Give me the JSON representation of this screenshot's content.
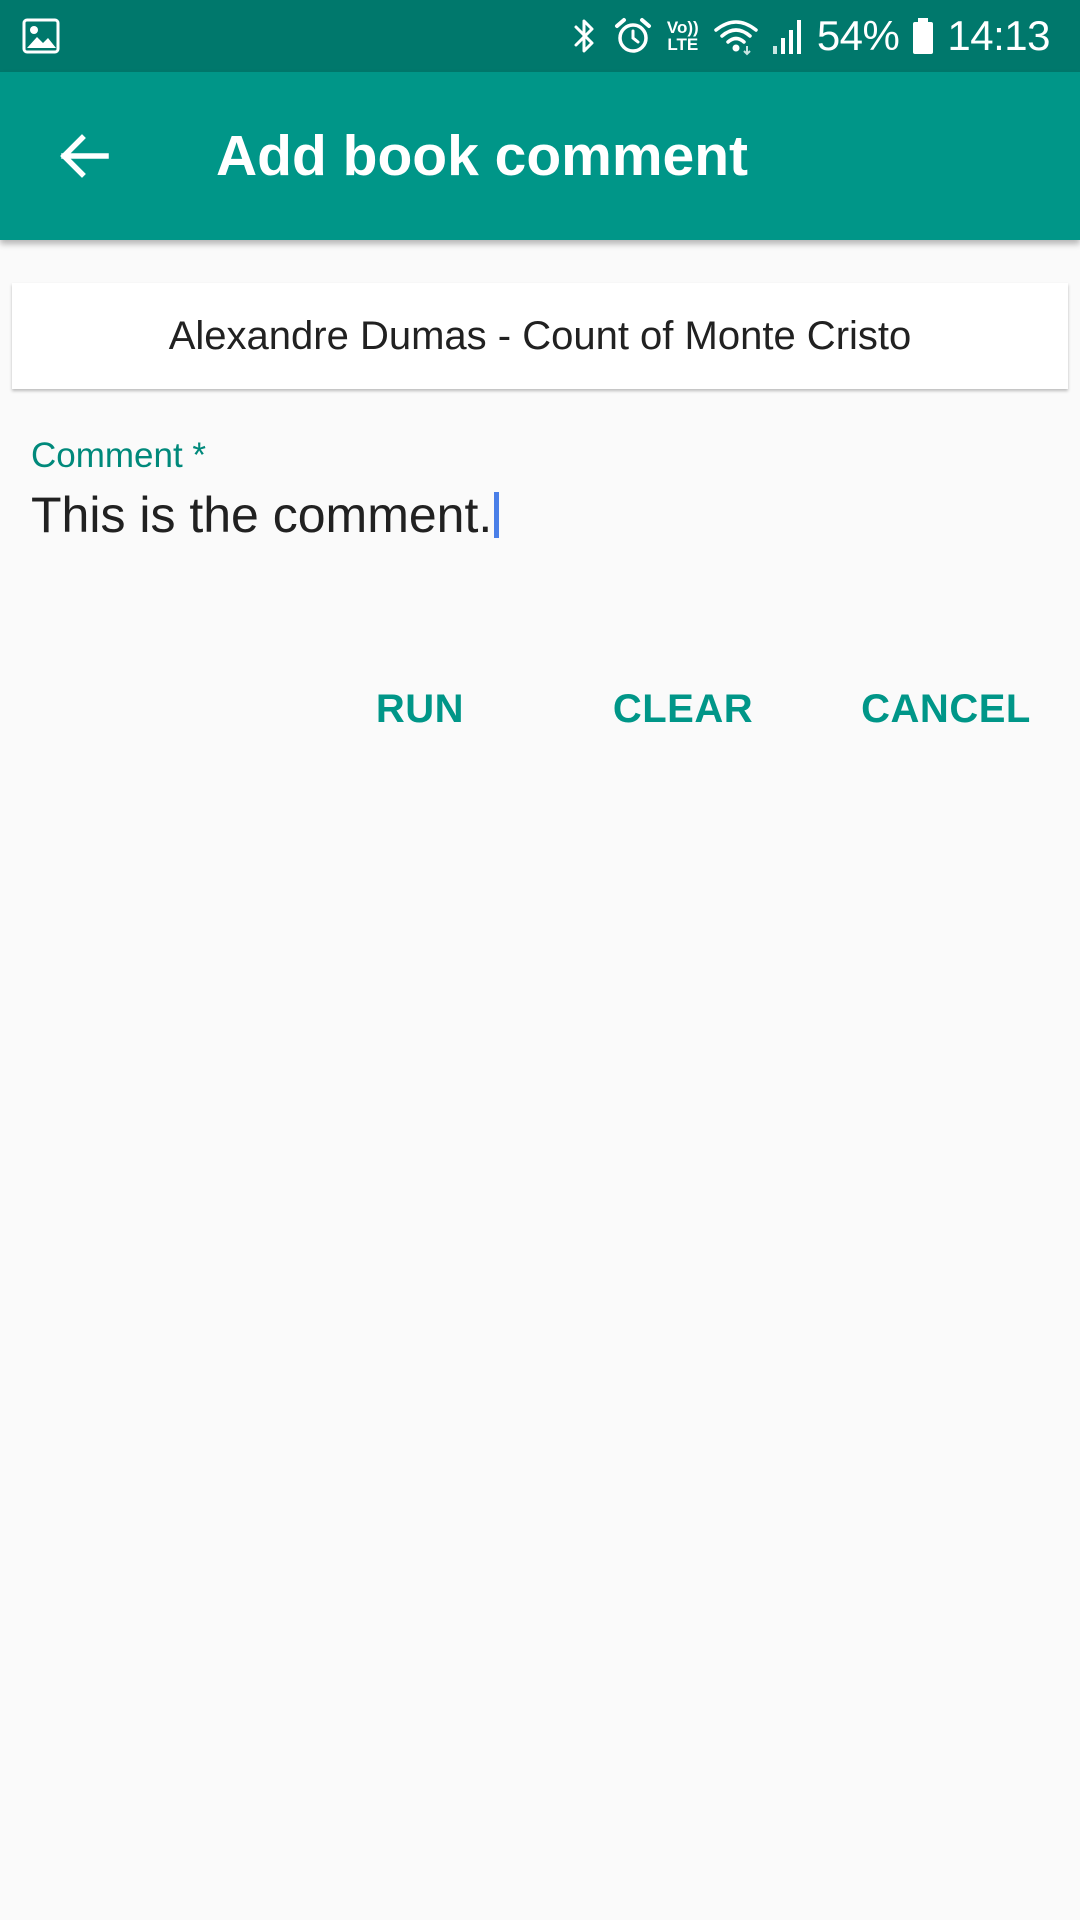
{
  "status_bar": {
    "icons": [
      "image-icon",
      "bluetooth-icon",
      "alarm-icon",
      "volte-icon",
      "wifi-icon",
      "signal-icon",
      "battery-icon"
    ],
    "volte_line1": "Vo))",
    "volte_line2": "LTE",
    "battery": "54%",
    "time": "14:13"
  },
  "app_bar": {
    "title": "Add book comment",
    "back_icon": "arrow-back-icon"
  },
  "book": {
    "title": "Alexandre Dumas - Count of Monte Cristo"
  },
  "form": {
    "comment_label": "Comment *",
    "comment_value": "This is the comment."
  },
  "actions": {
    "run": "RUN",
    "clear": "CLEAR",
    "cancel": "CANCEL"
  },
  "colors": {
    "status_bar": "#00786c",
    "primary": "#009688",
    "accent_text": "#00897b",
    "caret": "#4a7fe8",
    "background": "#fafafa"
  }
}
